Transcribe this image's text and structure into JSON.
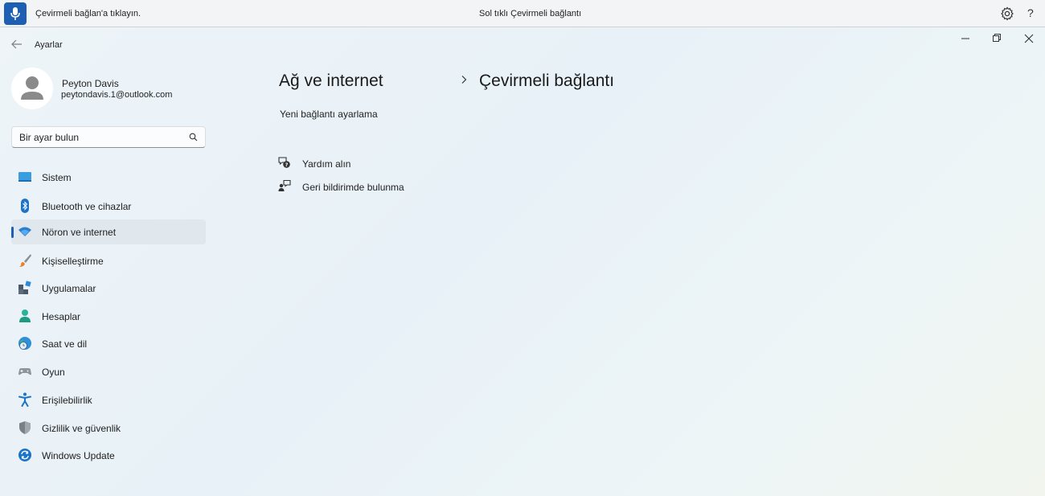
{
  "voice_bar": {
    "prompt": "Çevirmeli bağlan'a tıklayın.",
    "status": "Sol tıklı Çevirmeli bağlantı",
    "mic_icon": "microphone-icon",
    "settings_icon": "gear-icon",
    "help_label": "?"
  },
  "window": {
    "title": "Ayarlar",
    "back_icon": "back-arrow-icon",
    "controls": [
      "minimize-icon",
      "maximize-icon",
      "close-icon"
    ]
  },
  "profile": {
    "name": "Peyton Davis",
    "email": "peytondavis.1@outlook.com"
  },
  "search": {
    "placeholder": "Bir ayar bulun"
  },
  "sidebar": {
    "items": [
      {
        "label": "Sistem",
        "icon": "monitor-icon",
        "active": false
      },
      {
        "label": "Bluetooth ve cihazlar",
        "icon": "bluetooth-icon",
        "active": false
      },
      {
        "label": "Nöron ve internet",
        "icon": "wifi-icon",
        "active": true
      },
      {
        "label": "Kişiselleştirme",
        "icon": "paintbrush-icon",
        "active": false
      },
      {
        "label": "Uygulamalar",
        "icon": "apps-icon",
        "active": false
      },
      {
        "label": "Hesaplar",
        "icon": "person-icon",
        "active": false
      },
      {
        "label": "Saat ve dil",
        "icon": "globe-clock-icon",
        "active": false
      },
      {
        "label": "Oyun",
        "icon": "gamepad-icon",
        "active": false
      },
      {
        "label": "Erişilebilirlik",
        "icon": "accessibility-icon",
        "active": false
      },
      {
        "label": "Gizlilik ve güvenlik",
        "icon": "shield-icon",
        "active": false
      },
      {
        "label": "Windows Update",
        "icon": "refresh-icon",
        "active": false
      }
    ]
  },
  "main": {
    "breadcrumb_parent": "Ağ ve internet",
    "breadcrumb_current": "Çevirmeli bağlantı",
    "new_connection": "Yeni bağlantı ayarlama",
    "help_label": "Yardım alın",
    "feedback_label": "Geri bildirimde bulunma"
  },
  "colors": {
    "accent": "#1f5fb3",
    "active_item_bg": "#e0e8ee"
  }
}
